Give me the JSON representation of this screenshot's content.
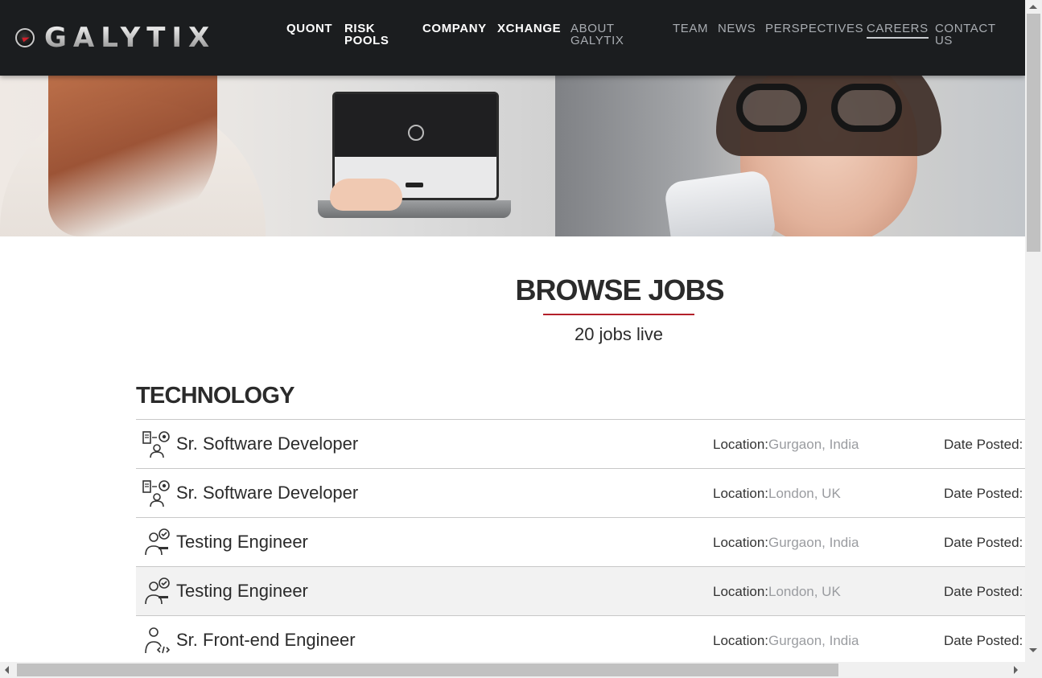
{
  "header": {
    "logo_text": "GALYTIX",
    "nav_primary": [
      "QUONT",
      "RISK\nPOOLS",
      "COMPANY",
      "XCHANGE"
    ],
    "nav_secondary": [
      "ABOUT\nGALYTIX",
      "TEAM",
      "NEWS",
      "PERSPECTIVES",
      "CAREERS",
      "CONTACT\nUS"
    ],
    "active_item": "CAREERS"
  },
  "hero": {
    "image": "hero-banner-image"
  },
  "browse": {
    "title": "BROWSE JOBS",
    "jobs_live": "20 jobs live"
  },
  "section": {
    "title": "TECHNOLOGY"
  },
  "jobs": [
    {
      "icon": "developer-icon",
      "title": "Sr. Software Developer",
      "location_label": "Location:",
      "location": "Gurgaon, India",
      "date_label": "Date Posted:"
    },
    {
      "icon": "developer-icon",
      "title": "Sr. Software Developer",
      "location_label": "Location:",
      "location": "London, UK",
      "date_label": "Date Posted:"
    },
    {
      "icon": "tester-icon",
      "title": "Testing Engineer",
      "location_label": "Location:",
      "location": "Gurgaon, India",
      "date_label": "Date Posted:"
    },
    {
      "icon": "tester-icon",
      "title": "Testing Engineer",
      "location_label": "Location:",
      "location": "London, UK",
      "date_label": "Date Posted:"
    },
    {
      "icon": "frontend-engineer-icon",
      "title": "Sr. Front-end Engineer",
      "location_label": "Location:",
      "location": "Gurgaon, India",
      "date_label": "Date Posted:"
    }
  ],
  "colors": {
    "header_bg": "#1b1d1f",
    "accent": "#b3202a",
    "location_value": "#9a9ca0",
    "row_hover": "#f2f2f2"
  }
}
